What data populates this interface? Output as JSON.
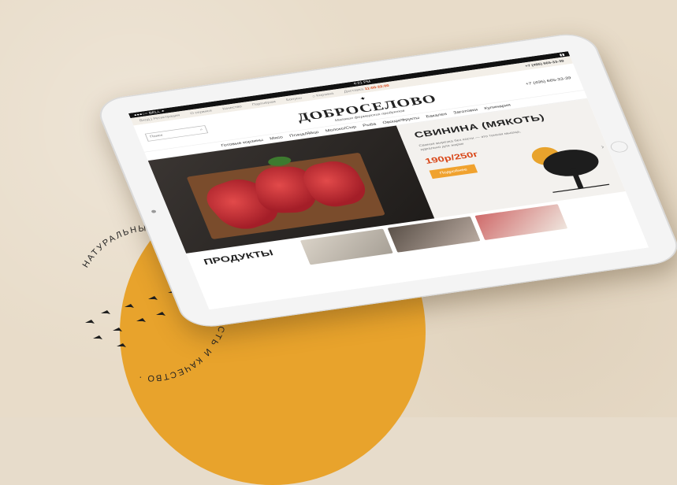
{
  "status_bar": {
    "carrier": "●●●○○ BELL ✦",
    "time": "4:21 PM"
  },
  "top_nav": {
    "items": [
      "Вход | Регистрация",
      "О сервисе",
      "Качество",
      "Партнёрам",
      "Бонусы",
      "Корзина"
    ],
    "delivery_label": "Доставка",
    "delivery_value": "11:00-22:00",
    "phone": "+7 (495) 665-33-39"
  },
  "header": {
    "search_placeholder": "Поиск",
    "logo_name": "ДОБРОСЕЛОВО",
    "logo_subtitle": "Магазин фермерских продуктов",
    "phone_secondary": "+7 (495) 665-33-39"
  },
  "category_nav": {
    "items": [
      "Готовые корзины",
      "Мясо",
      "Птица/Яйцо",
      "Молоко/Сыр",
      "Рыба",
      "Овощи/Фрукты",
      "Бакалея",
      "Заготовки",
      "Кулинария"
    ]
  },
  "hero": {
    "title": "СВИНИНА (МЯКОТЬ)",
    "description": "Свиная вырезка без кости — это тонкая мышца, идеально для жарки",
    "price": "190р/250г",
    "button_label": "Подробнее"
  },
  "products_heading": "ПРОДУКТЫ",
  "emblem": {
    "ring_text": "НАТУРАЛЬНЫЕ ФЕРМЕРСКИЕ · СВЕЖЕСТЬ И КАЧЕСТВО ·"
  },
  "colors": {
    "accent_orange": "#e8a32c",
    "price_red": "#d9481a",
    "background_kraft": "#e8dcc9"
  }
}
